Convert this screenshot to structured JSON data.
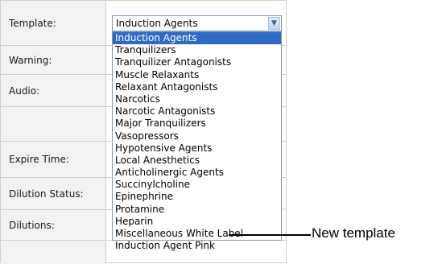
{
  "form": {
    "labels": {
      "template": "Template:",
      "warning": "Warning:",
      "audio": "Audio:",
      "expire_time": "Expire Time:",
      "dilution_status": "Dilution Status:",
      "dilutions": "Dilutions:"
    },
    "template_select": {
      "value": "Induction Agents",
      "options": [
        "Induction Agents",
        "Tranquilizers",
        "Tranquilizer Antagonists",
        "Muscle Relaxants",
        "Relaxant Antagonists",
        "Narcotics",
        "Narcotic Antagonists",
        "Major Tranquilizers",
        "Vasopressors",
        "Hypotensive Agents",
        "Local Anesthetics",
        "Anticholinergic Agents",
        "Succinylcholine",
        "Epinephrine",
        "Protamine",
        "Heparin",
        "Miscellaneous White Label",
        "Induction Agent Pink"
      ]
    }
  },
  "annotation": {
    "text": "New template"
  },
  "colors": {
    "selected_bg": "#316ac5",
    "label_bg": "#f2f2f2",
    "border": "#cfcfcf"
  },
  "icons": {
    "dropdown_arrow": "chevron-down-icon"
  }
}
